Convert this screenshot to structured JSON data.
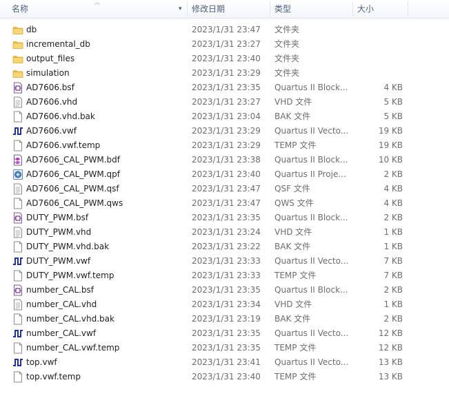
{
  "columns": {
    "name": "名称",
    "date": "修改日期",
    "type": "类型",
    "size": "大小"
  },
  "files": [
    {
      "name": "db",
      "date": "2023/1/31 23:47",
      "type": "文件夹",
      "size": "",
      "icon": "folder-icon"
    },
    {
      "name": "incremental_db",
      "date": "2023/1/31 23:27",
      "type": "文件夹",
      "size": "",
      "icon": "folder-icon"
    },
    {
      "name": "output_files",
      "date": "2023/1/31 23:40",
      "type": "文件夹",
      "size": "",
      "icon": "folder-icon"
    },
    {
      "name": "simulation",
      "date": "2023/1/31 23:29",
      "type": "文件夹",
      "size": "",
      "icon": "folder-icon"
    },
    {
      "name": "AD7606.bsf",
      "date": "2023/1/31 23:35",
      "type": "Quartus II Block...",
      "size": "4 KB",
      "icon": "block-symbol-file-icon"
    },
    {
      "name": "AD7606.vhd",
      "date": "2023/1/31 23:27",
      "type": "VHD 文件",
      "size": "5 KB",
      "icon": "text-file-icon"
    },
    {
      "name": "AD7606.vhd.bak",
      "date": "2023/1/31 23:04",
      "type": "BAK 文件",
      "size": "5 KB",
      "icon": "blank-file-icon"
    },
    {
      "name": "AD7606.vwf",
      "date": "2023/1/31 23:29",
      "type": "Quartus II Vecto...",
      "size": "19 KB",
      "icon": "waveform-file-icon"
    },
    {
      "name": "AD7606.vwf.temp",
      "date": "2023/1/31 23:29",
      "type": "TEMP 文件",
      "size": "19 KB",
      "icon": "blank-file-icon"
    },
    {
      "name": "AD7606_CAL_PWM.bdf",
      "date": "2023/1/31 23:38",
      "type": "Quartus II Block...",
      "size": "10 KB",
      "icon": "block-diagram-file-icon"
    },
    {
      "name": "AD7606_CAL_PWM.qpf",
      "date": "2023/1/31 23:40",
      "type": "Quartus II Proje...",
      "size": "2 KB",
      "icon": "quartus-project-icon"
    },
    {
      "name": "AD7606_CAL_PWM.qsf",
      "date": "2023/1/31 23:47",
      "type": "QSF 文件",
      "size": "4 KB",
      "icon": "text-file-icon"
    },
    {
      "name": "AD7606_CAL_PWM.qws",
      "date": "2023/1/31 23:47",
      "type": "QWS 文件",
      "size": "4 KB",
      "icon": "blank-file-icon"
    },
    {
      "name": "DUTY_PWM.bsf",
      "date": "2023/1/31 23:35",
      "type": "Quartus II Block...",
      "size": "2 KB",
      "icon": "block-symbol-file-icon"
    },
    {
      "name": "DUTY_PWM.vhd",
      "date": "2023/1/31 23:24",
      "type": "VHD 文件",
      "size": "1 KB",
      "icon": "text-file-icon"
    },
    {
      "name": "DUTY_PWM.vhd.bak",
      "date": "2023/1/31 23:22",
      "type": "BAK 文件",
      "size": "1 KB",
      "icon": "blank-file-icon"
    },
    {
      "name": "DUTY_PWM.vwf",
      "date": "2023/1/31 23:33",
      "type": "Quartus II Vecto...",
      "size": "7 KB",
      "icon": "waveform-file-icon"
    },
    {
      "name": "DUTY_PWM.vwf.temp",
      "date": "2023/1/31 23:33",
      "type": "TEMP 文件",
      "size": "7 KB",
      "icon": "blank-file-icon"
    },
    {
      "name": "number_CAL.bsf",
      "date": "2023/1/31 23:35",
      "type": "Quartus II Block...",
      "size": "2 KB",
      "icon": "block-symbol-file-icon"
    },
    {
      "name": "number_CAL.vhd",
      "date": "2023/1/31 23:34",
      "type": "VHD 文件",
      "size": "1 KB",
      "icon": "text-file-icon"
    },
    {
      "name": "number_CAL.vhd.bak",
      "date": "2023/1/31 23:19",
      "type": "BAK 文件",
      "size": "2 KB",
      "icon": "blank-file-icon"
    },
    {
      "name": "number_CAL.vwf",
      "date": "2023/1/31 23:35",
      "type": "Quartus II Vecto...",
      "size": "12 KB",
      "icon": "waveform-file-icon"
    },
    {
      "name": "number_CAL.vwf.temp",
      "date": "2023/1/31 23:35",
      "type": "TEMP 文件",
      "size": "12 KB",
      "icon": "blank-file-icon"
    },
    {
      "name": "top.vwf",
      "date": "2023/1/31 23:41",
      "type": "Quartus II Vecto...",
      "size": "13 KB",
      "icon": "waveform-file-icon"
    },
    {
      "name": "top.vwf.temp",
      "date": "2023/1/31 23:40",
      "type": "TEMP 文件",
      "size": "13 KB",
      "icon": "blank-file-icon"
    }
  ]
}
